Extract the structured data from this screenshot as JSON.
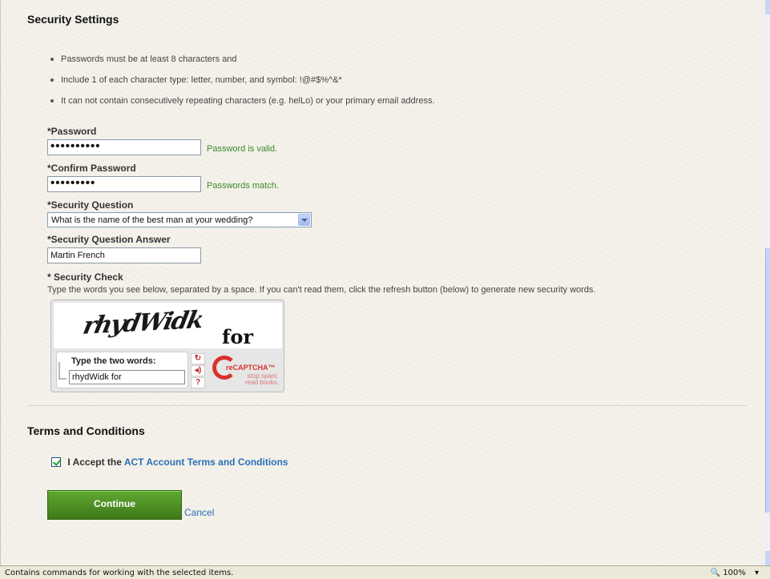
{
  "security": {
    "title": "Security Settings",
    "rules": [
      "Passwords must be at least 8 characters and",
      "Include 1 of each character type: letter, number, and symbol: !@#$%^&*",
      "It can not contain consecutively repeating characters (e.g. helLo) or your primary email address."
    ],
    "password_label": "*Password",
    "password_value": "••••••••••",
    "password_status": "Password is valid.",
    "confirm_label": "*Confirm Password",
    "confirm_value": "•••••••••",
    "confirm_status": "Passwords match.",
    "question_label": "*Security Question",
    "question_value": "What is the name of the best man at your wedding?",
    "answer_label": "*Security Question Answer",
    "answer_value": "Martin French",
    "check_label": "* Security Check",
    "check_helper": "Type the words you see below, separated by a space. If you can't read them, click the refresh button (below) to generate new security words."
  },
  "captcha": {
    "word1": "rhydWidk",
    "word2": "for",
    "prompt": "Type the two words:",
    "input_value": "rhydWidk for",
    "brand": "reCAPTCHA™",
    "tagline_1": "stop spam.",
    "tagline_2": "read books."
  },
  "terms": {
    "title": "Terms and Conditions",
    "accept_prefix": "I Accept the",
    "accept_link": "ACT Account Terms and Conditions",
    "checked": true
  },
  "actions": {
    "continue_label": "Continue",
    "cancel_label": "Cancel"
  },
  "statusbar": {
    "text": "Contains commands for working with the selected items.",
    "zoom": "100%"
  }
}
